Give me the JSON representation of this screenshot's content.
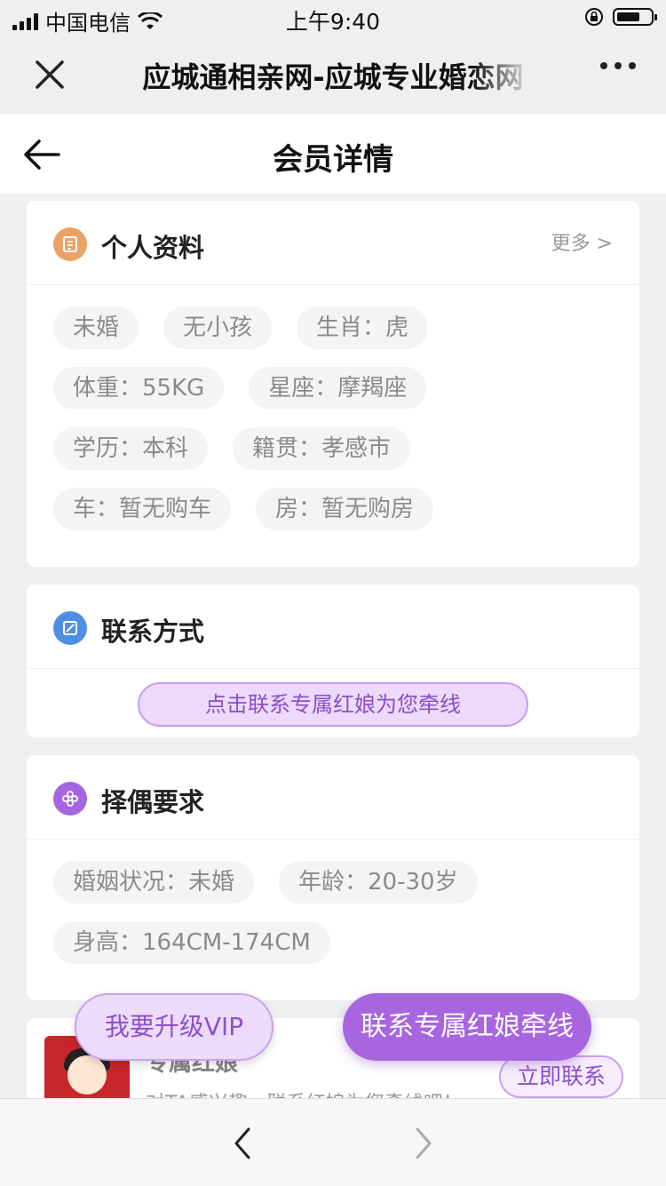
{
  "status": {
    "carrier": "中国电信",
    "time": "上午9:40"
  },
  "titlebar": {
    "title": "应城通相亲网-应城专业婚恋网"
  },
  "navbar": {
    "title": "会员详情"
  },
  "profile": {
    "title": "个人资料",
    "more": "更多 >",
    "tags": [
      "未婚",
      "无小孩",
      "生肖：虎",
      "体重：55KG",
      "星座：摩羯座",
      "学历：本科",
      "籍贯：孝感市",
      "车：暂无购车",
      "房：暂无购房"
    ]
  },
  "contact": {
    "title": "联系方式",
    "button": "点击联系专属红娘为您牵线"
  },
  "requirements": {
    "title": "择偶要求",
    "tags": [
      "婚姻状况：未婚",
      "年龄：20-30岁",
      "身高：164CM-174CM"
    ]
  },
  "ad": {
    "title": "专属红娘",
    "desc": "对TA感兴趣，联系红娘为您牵线吧！",
    "button": "立即联系"
  },
  "floating": {
    "vip": "我要升级VIP",
    "contact": "联系专属红娘牵线"
  },
  "colors": {
    "accent": "#a865e0",
    "profile_icon": "#e9a366",
    "contact_icon": "#4f8fe3",
    "req_icon": "#a665e0"
  }
}
